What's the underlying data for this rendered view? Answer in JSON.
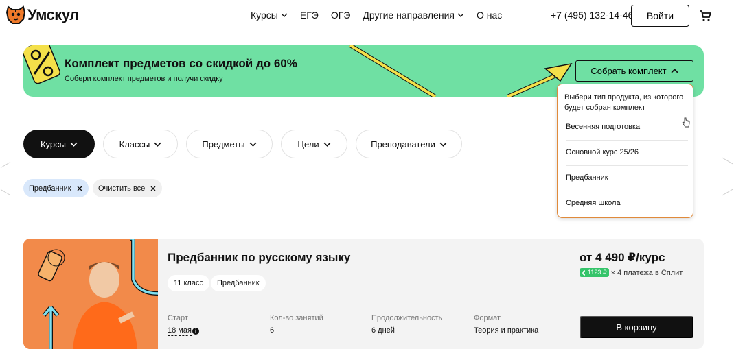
{
  "header": {
    "logo_text": "Умскул",
    "nav": [
      {
        "label": "Курсы",
        "has_dropdown": true
      },
      {
        "label": "ЕГЭ",
        "has_dropdown": false
      },
      {
        "label": "ОГЭ",
        "has_dropdown": false
      },
      {
        "label": "Другие направления",
        "has_dropdown": true
      },
      {
        "label": "О нас",
        "has_dropdown": false
      }
    ],
    "phone": "+7 (495) 132-14-46",
    "login_label": "Войти",
    "cart_icon": "cart-icon"
  },
  "promo": {
    "title": "Комплект предметов со скидкой до 60%",
    "subtitle": "Собери комплект предметов и получи скидку",
    "button_label": "Собрать комплект",
    "background_color": "#6fe0a3",
    "icon": "percent-icon"
  },
  "dropdown": {
    "heading": "Выбери тип продукта, из которого будет собран комплект",
    "items": [
      "Весенняя подготовка",
      "Основной курс 25/26",
      "Предбанник",
      "Средняя школа"
    ],
    "border_color": "#e08a3a"
  },
  "filters": [
    {
      "label": "Курсы",
      "active": true
    },
    {
      "label": "Классы",
      "active": false
    },
    {
      "label": "Предметы",
      "active": false
    },
    {
      "label": "Цели",
      "active": false
    },
    {
      "label": "Преподаватели",
      "active": false
    }
  ],
  "chips": [
    {
      "label": "Предбанник",
      "style": "blue"
    },
    {
      "label": "Очистить все",
      "style": "gray"
    }
  ],
  "course_card": {
    "title": "Предбанник по русскому языку",
    "tags": [
      "11 класс",
      "Предбанник"
    ],
    "meta": [
      {
        "label": "Старт",
        "value": "18 мая"
      },
      {
        "label": "Кол-во занятий",
        "value": "6"
      },
      {
        "label": "Продолжительность",
        "value": "6 дней"
      },
      {
        "label": "Формат",
        "value": "Теория и практика"
      }
    ],
    "price": "от 4 490 ₽/курс",
    "split_amount": "1123 ₽",
    "split_text": "× 4 платежа в Сплит",
    "cart_button": "В корзину",
    "image_background": "#f28a4a"
  }
}
